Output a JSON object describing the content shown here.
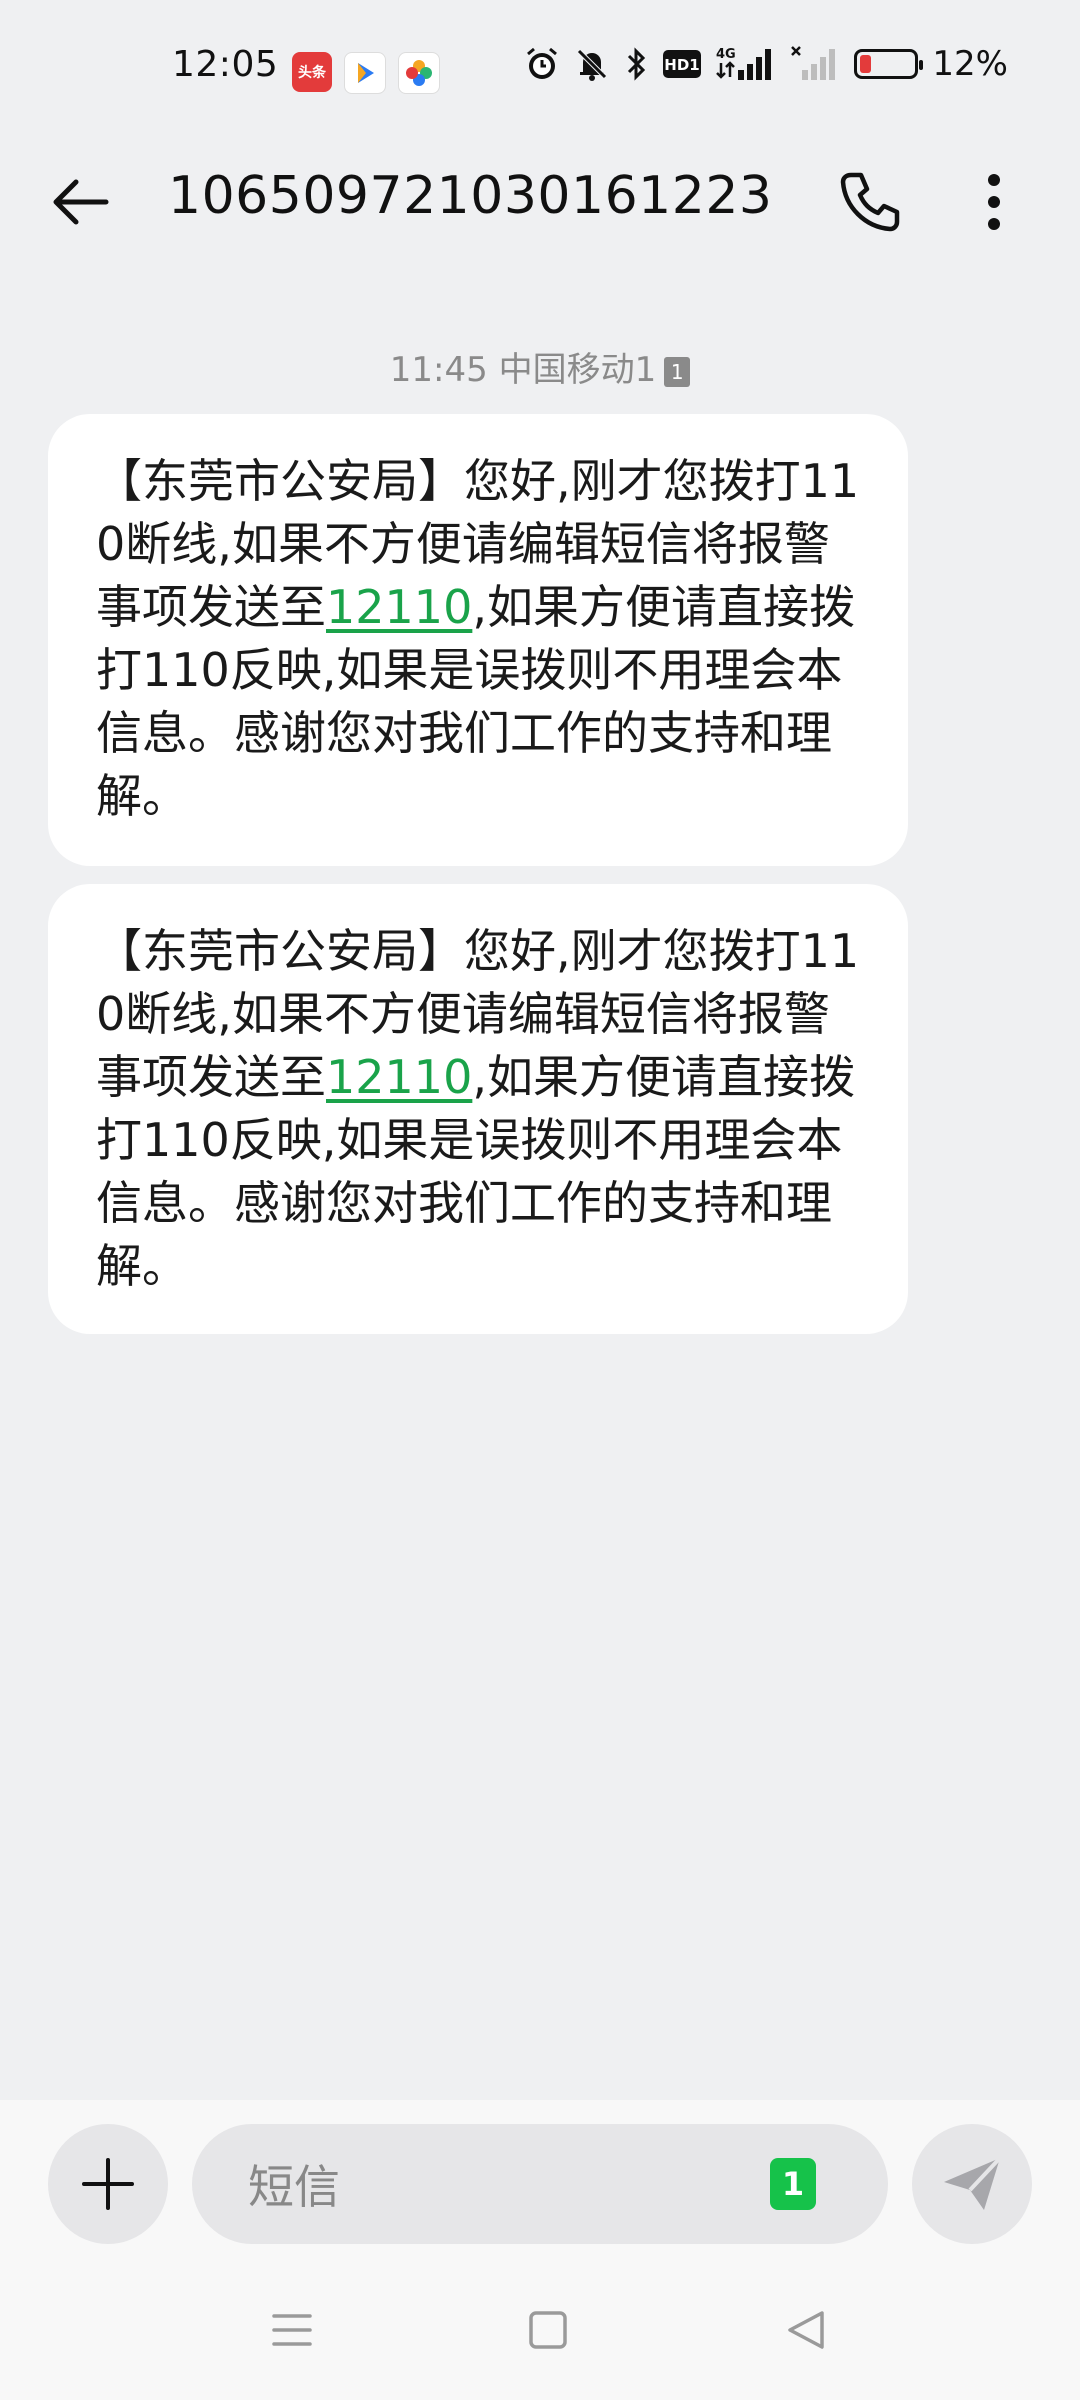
{
  "status_bar": {
    "time": "12:05",
    "apps": [
      "头条"
    ],
    "network": "4G",
    "hd_label": "HD1",
    "battery_percent": 12,
    "battery_text": "12%"
  },
  "header": {
    "title": "10650972103016​1223"
  },
  "conversation": {
    "meta_time": "11:45",
    "meta_carrier": "中国移动1",
    "meta_sim": "1",
    "messages": [
      {
        "text_before": "【东莞市公安局】您好,刚才您拨打110断线,如果不方便请编辑短信将报警事项发送至",
        "link": "12110",
        "text_after": ",如果方便请直接拨打110反映,如果是误拨则不用理会本信息。感谢您对我们工作的支持和理解。"
      },
      {
        "text_before": "【东莞市公安局】您好,刚才您拨打110断线,如果不方便请编辑短信将报警事项发送至",
        "link": "12110",
        "text_after": ",如果方便请直接拨打110反映,如果是误拨则不用理会本信息。感谢您对我们工作的支持和理解。"
      }
    ]
  },
  "composer": {
    "placeholder": "短信",
    "sim_tag": "1"
  },
  "colors": {
    "background": "#eff0f2",
    "bubble": "#ffffff",
    "link": "#1aa34a",
    "sim_tag": "#16c24a",
    "battery_low": "#e33b3b"
  },
  "icons": {
    "back": "arrow-left-icon",
    "call": "phone-icon",
    "more": "more-vertical-icon",
    "add": "plus-icon",
    "send": "send-icon",
    "nav_menu": "menu-icon",
    "nav_home": "home-square-icon",
    "nav_back": "triangle-back-icon"
  }
}
